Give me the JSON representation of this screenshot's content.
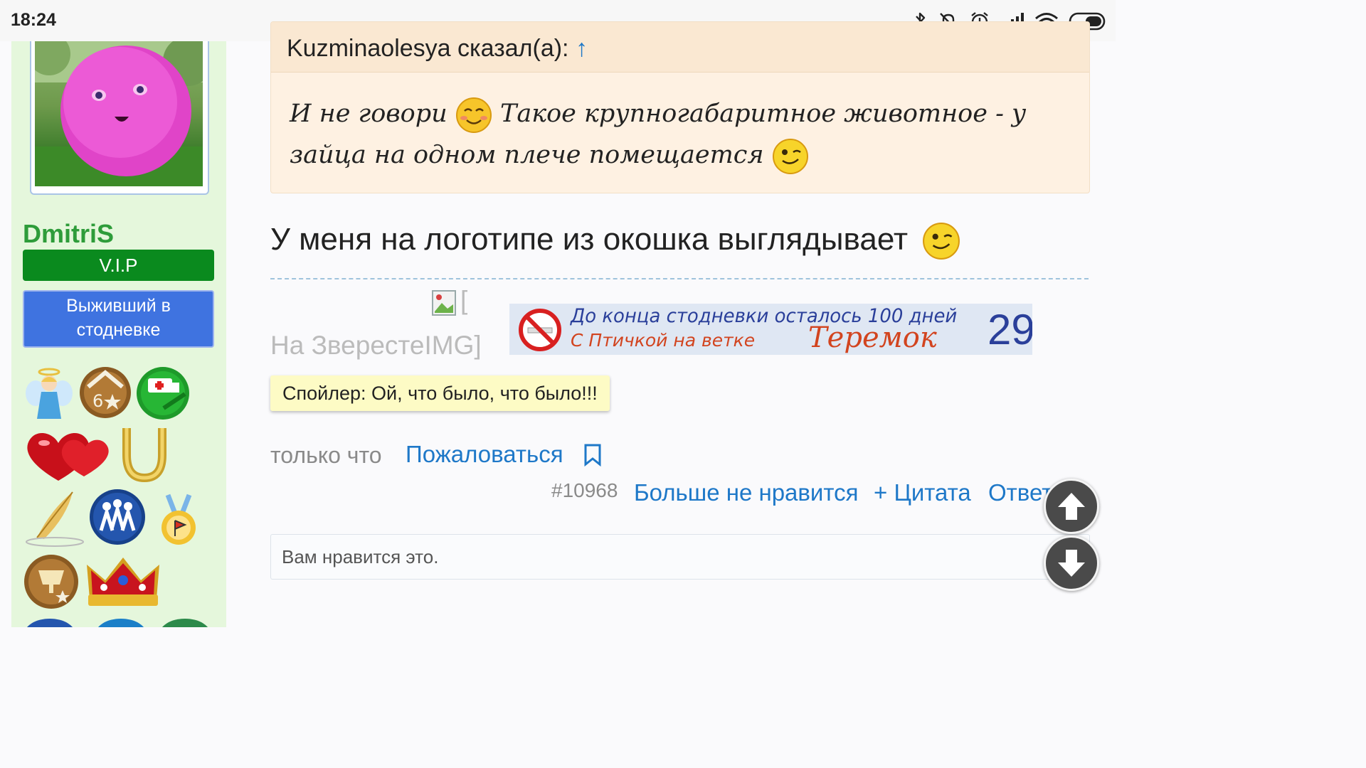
{
  "status_bar": {
    "time": "18:24",
    "icons": [
      "bluetooth-icon",
      "mute-icon",
      "alarm-icon",
      "signal-icon",
      "wifi-icon",
      "battery-icon"
    ]
  },
  "sidebar": {
    "username": "DmitriS",
    "rank_vip": "V.I.P",
    "rank_title": "Выживший в стодневке",
    "awards": [
      "angel-award",
      "stars-award",
      "ambulance-award",
      "hearts-award",
      "horseshoe-award",
      "quill-award",
      "people-award",
      "medal-award",
      "cup-award",
      "crown-award"
    ]
  },
  "quote": {
    "author": "Kuzminaolesya сказал(а):",
    "arrow": "↑",
    "text_1": "И не говори",
    "text_2": "Такое крупногабаритное животное - у зайца на одном плече помещается"
  },
  "post": {
    "text": "У меня на логотипе из окошка выглядывает",
    "broken_image_prefix": "[",
    "broken_image_text": "На ЗверестеIMG]",
    "banner": {
      "line1": "До конца стодневки осталось 100 дней",
      "line2": "С Птичкой на ветке",
      "name": "Теремок",
      "count": "29"
    },
    "spoiler": "Спойлер: Ой, что было, что было!!!",
    "time": "только что",
    "report": "Пожаловаться",
    "post_number": "#10968",
    "unlike": "Больше не нравится",
    "quote_action": "+ Цитата",
    "reply": "Ответить"
  },
  "likes": {
    "text": "Вам нравится это."
  },
  "colors": {
    "link": "#1e78c8",
    "username": "#2e9c3a",
    "vip_badge": "#0a8a1e",
    "rank_badge": "#3f73e0",
    "sidebar_bg": "#e5f7dc",
    "quote_bg": "#fef1e2",
    "spoiler_bg": "#fdfbc5"
  }
}
